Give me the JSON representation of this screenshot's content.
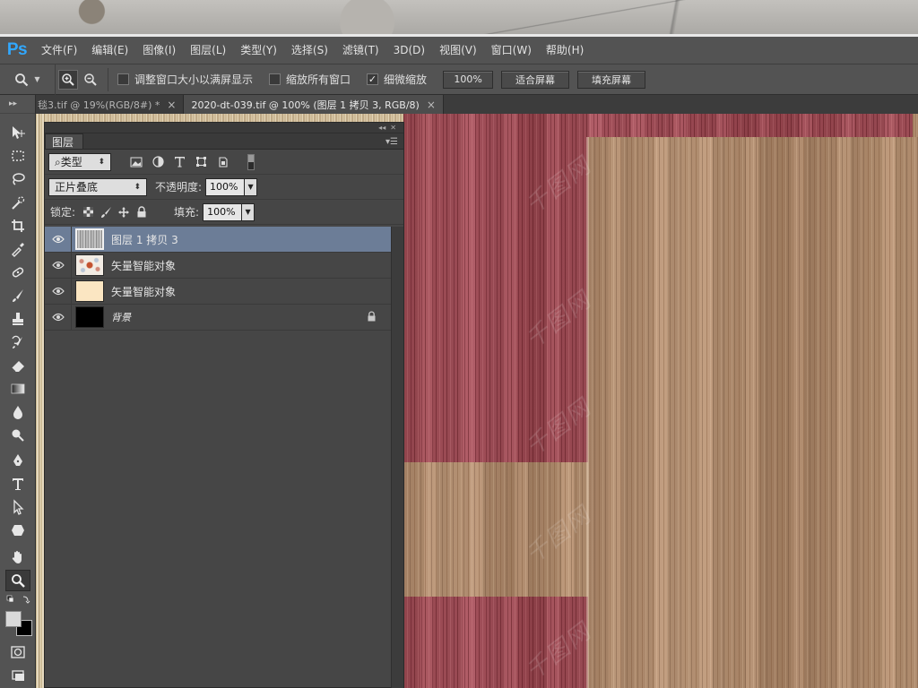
{
  "menu": {
    "logo": "Ps",
    "items": [
      "文件(F)",
      "编辑(E)",
      "图像(I)",
      "图层(L)",
      "类型(Y)",
      "选择(S)",
      "滤镜(T)",
      "3D(D)",
      "视图(V)",
      "窗口(W)",
      "帮助(H)"
    ]
  },
  "options": {
    "resize_windows_label": "调整窗口大小以满屏显示",
    "resize_windows_checked": false,
    "zoom_all_label": "缩放所有窗口",
    "zoom_all_checked": false,
    "scrubby_zoom_label": "细微缩放",
    "scrubby_zoom_checked": true,
    "zoom_100_label": "100%",
    "fit_screen_label": "适合屏幕",
    "fill_screen_label": "填充屏幕"
  },
  "tabs": [
    {
      "label": "毯3.tif @ 19%(RGB/8#) *",
      "close": "×",
      "active": false
    },
    {
      "label": "2020-dt-039.tif @ 100% (图层 1 拷贝 3, RGB/8)",
      "close": "×",
      "active": true
    }
  ],
  "layers_panel": {
    "title": "图层",
    "filter_label": "类型",
    "blend_mode": "正片叠底",
    "opacity_label": "不透明度:",
    "opacity_value": "100%",
    "lock_label": "锁定:",
    "fill_label": "填充:",
    "fill_value": "100%",
    "layers": [
      {
        "name": "图层 1 拷贝 3",
        "selected": true,
        "visible": true,
        "thumb": "wood-gray",
        "locked": false
      },
      {
        "name": "矢量智能对象",
        "selected": false,
        "visible": true,
        "thumb": "pattern",
        "locked": false
      },
      {
        "name": "矢量智能对象",
        "selected": false,
        "visible": true,
        "thumb": "cream",
        "locked": false
      },
      {
        "name": "背景",
        "selected": false,
        "visible": true,
        "thumb": "black",
        "locked": true
      }
    ]
  },
  "canvas": {
    "watermark": "千图网"
  },
  "colors": {
    "ui_dark": "#535353",
    "panel": "#464646",
    "selection": "#6c7d97",
    "ps_blue": "#31a8ff",
    "wood_red": "#a24c55",
    "wood_light": "#b08a6b"
  }
}
